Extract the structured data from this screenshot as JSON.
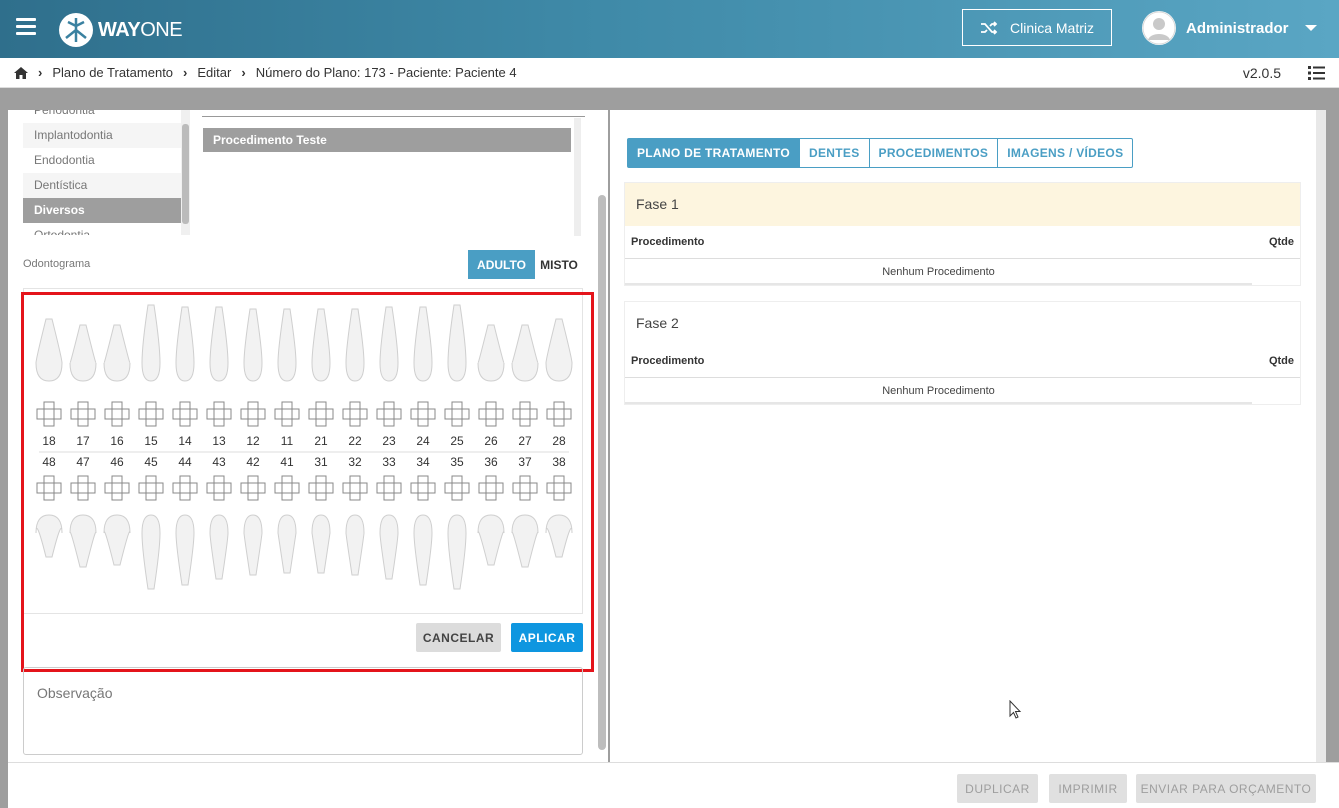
{
  "header": {
    "logo_text_a": "WAY",
    "logo_text_b": "ONE",
    "clinic_label": "Clinica Matriz",
    "user_name": "Administrador"
  },
  "breadcrumb": {
    "items": [
      "Plano de Tratamento",
      "Editar",
      "Número do Plano: 173 - Paciente: Paciente 4"
    ],
    "version": "v2.0.5"
  },
  "left": {
    "specialties": [
      "Periodontia",
      "Implantodontia",
      "Endodontia",
      "Dentística",
      "Diversos",
      "Ortodontia"
    ],
    "active_specialty": "Diversos",
    "procedure_item": "Procedimento Teste",
    "odontogram_label": "Odontograma",
    "toggle_adult": "ADULTO",
    "toggle_mixed": "MISTO",
    "upper_teeth": [
      "18",
      "17",
      "16",
      "15",
      "14",
      "13",
      "12",
      "11",
      "21",
      "22",
      "23",
      "24",
      "25",
      "26",
      "27",
      "28"
    ],
    "lower_teeth": [
      "48",
      "47",
      "46",
      "45",
      "44",
      "43",
      "42",
      "41",
      "31",
      "32",
      "33",
      "34",
      "35",
      "36",
      "37",
      "38"
    ],
    "cancel_label": "CANCELAR",
    "apply_label": "APLICAR",
    "observation_placeholder": "Observação"
  },
  "right": {
    "tabs": [
      "PLANO DE TRATAMENTO",
      "DENTES",
      "PROCEDIMENTOS",
      "IMAGENS / VÍDEOS"
    ],
    "phases": [
      {
        "title": "Fase 1",
        "col_proc": "Procedimento",
        "col_qty": "Qtde",
        "empty": "Nenhum Procedimento",
        "highlight": "#fdf5df"
      },
      {
        "title": "Fase 2",
        "col_proc": "Procedimento",
        "col_qty": "Qtde",
        "empty": "Nenhum Procedimento",
        "highlight": "#ffffff"
      }
    ]
  },
  "footer": {
    "duplicate_label": "DUPLICAR",
    "print_label": "IMPRIMIR",
    "send_label": "ENVIAR PARA ORÇAMENTO"
  },
  "colors": {
    "accent": "#4a9ec4",
    "apply": "#0e96e0",
    "highlight_frame": "#e4141b"
  }
}
